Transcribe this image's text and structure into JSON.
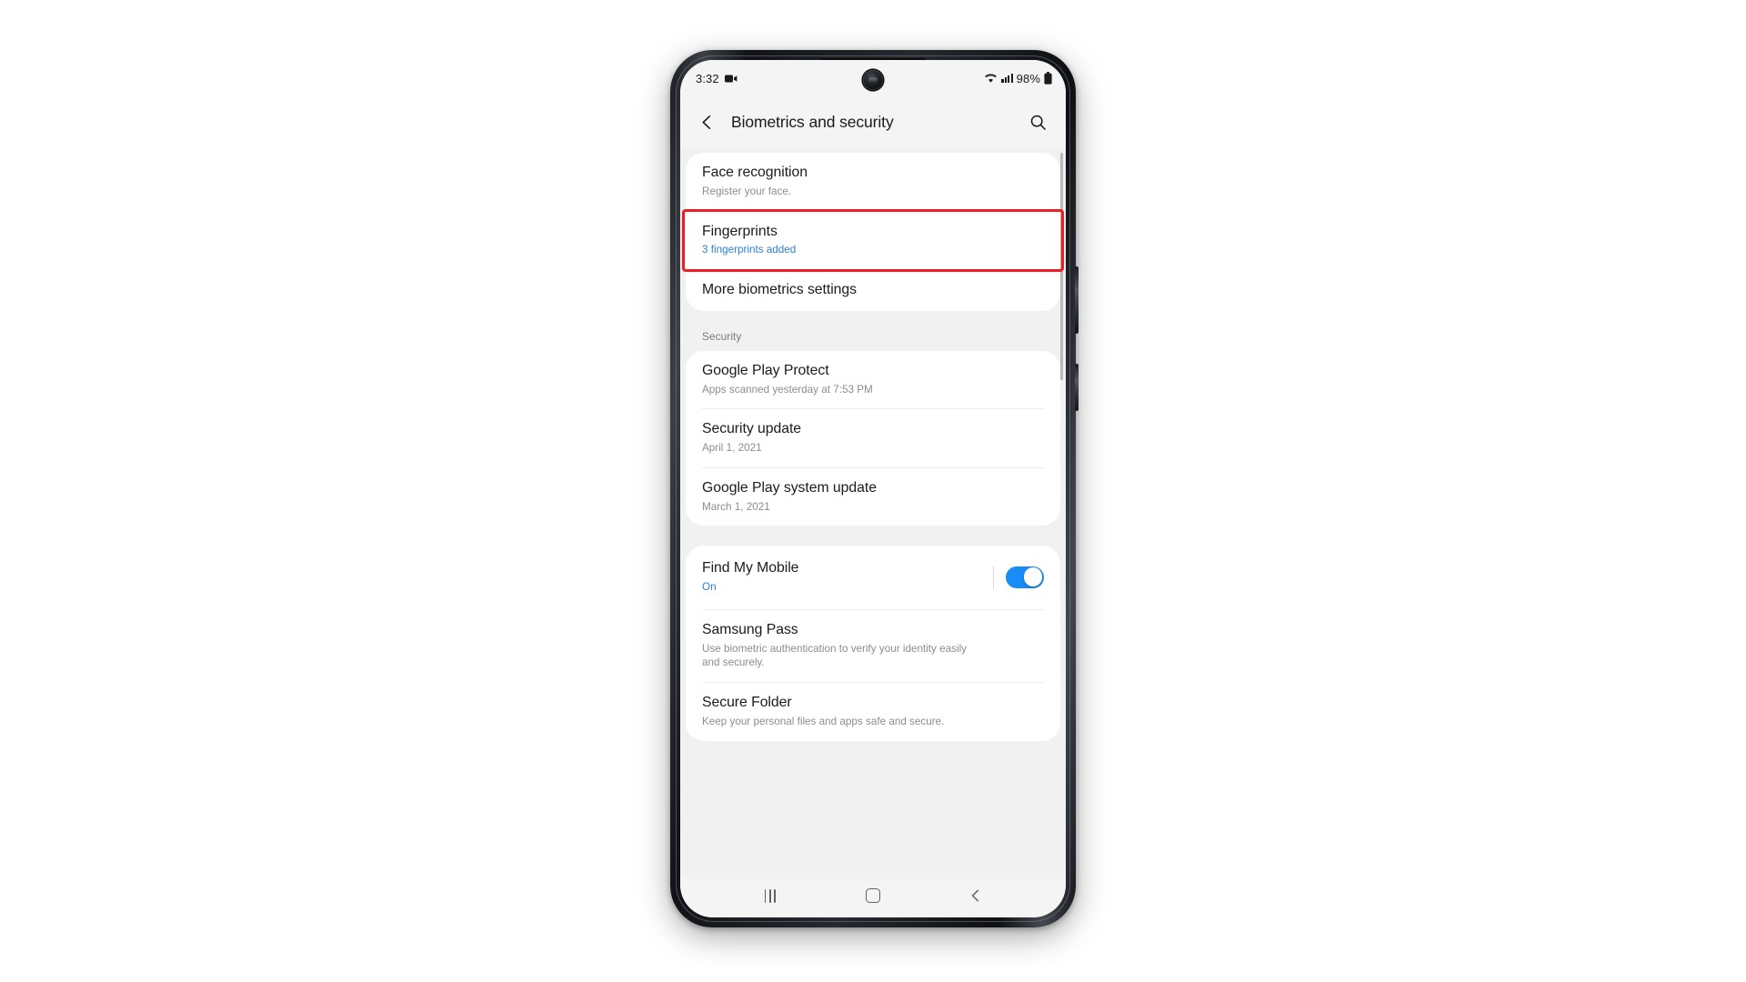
{
  "device": {
    "type": "samsung-galaxy-phone",
    "hardware_buttons": [
      "volume-rocker",
      "power-button"
    ]
  },
  "statusbar": {
    "clock": "3:32",
    "left_icons": [
      {
        "name": "screen-recorder-icon",
        "glyph": "video-camera"
      }
    ],
    "right_icons": [
      {
        "name": "wifi-icon"
      },
      {
        "name": "cellular-signal-icon"
      }
    ],
    "battery_percent": "98%",
    "battery_icon": "battery-full-icon"
  },
  "appbar": {
    "back_icon": "back-chevron-icon",
    "title": "Biometrics and security",
    "search_icon": "search-icon"
  },
  "content": {
    "groups": [
      {
        "id": "biometrics",
        "section_label": null,
        "rows": [
          {
            "name": "face-recognition",
            "title": "Face recognition",
            "subtitle": "Register your face.",
            "subtitle_accent": false,
            "highlighted": false,
            "toggle": null
          },
          {
            "name": "fingerprints",
            "title": "Fingerprints",
            "subtitle": "3 fingerprints added",
            "subtitle_accent": true,
            "highlighted": true,
            "toggle": null
          },
          {
            "name": "more-biometrics-settings",
            "title": "More biometrics settings",
            "subtitle": null,
            "subtitle_accent": false,
            "highlighted": false,
            "toggle": null
          }
        ]
      },
      {
        "id": "security",
        "section_label": "Security",
        "rows": [
          {
            "name": "google-play-protect",
            "title": "Google Play Protect",
            "subtitle": "Apps scanned yesterday at 7:53 PM",
            "subtitle_accent": false,
            "highlighted": false,
            "toggle": null
          },
          {
            "name": "security-update",
            "title": "Security update",
            "subtitle": "April 1, 2021",
            "subtitle_accent": false,
            "highlighted": false,
            "toggle": null
          },
          {
            "name": "google-play-system-update",
            "title": "Google Play system update",
            "subtitle": "March 1, 2021",
            "subtitle_accent": false,
            "highlighted": false,
            "toggle": null
          }
        ]
      },
      {
        "id": "tools",
        "section_label": null,
        "rows": [
          {
            "name": "find-my-mobile",
            "title": "Find My Mobile",
            "subtitle": "On",
            "subtitle_accent": true,
            "highlighted": false,
            "toggle": {
              "state": "on",
              "color": "#1a8cf5"
            }
          },
          {
            "name": "samsung-pass",
            "title": "Samsung Pass",
            "subtitle": "Use biometric authentication to verify your identity easily and securely.",
            "subtitle_accent": false,
            "highlighted": false,
            "toggle": null
          },
          {
            "name": "secure-folder",
            "title": "Secure Folder",
            "subtitle": "Keep your personal files and apps safe and secure.",
            "subtitle_accent": false,
            "highlighted": false,
            "toggle": null
          }
        ]
      }
    ]
  },
  "navbar": {
    "buttons": [
      {
        "name": "nav-recents-button",
        "icon": "recents-icon"
      },
      {
        "name": "nav-home-button",
        "icon": "home-icon"
      },
      {
        "name": "nav-back-button",
        "icon": "back-chevron-icon"
      }
    ]
  },
  "annotation": {
    "highlight_color": "#ec1d24",
    "target_row": "fingerprints"
  },
  "colors": {
    "accent_blue": "#2e7fd6",
    "toggle_on": "#1a8cf5",
    "highlight_red": "#ec1d24",
    "screen_bg": "#f1f1f1",
    "card_bg": "#ffffff",
    "bar_bg": "#f4f4f4"
  }
}
